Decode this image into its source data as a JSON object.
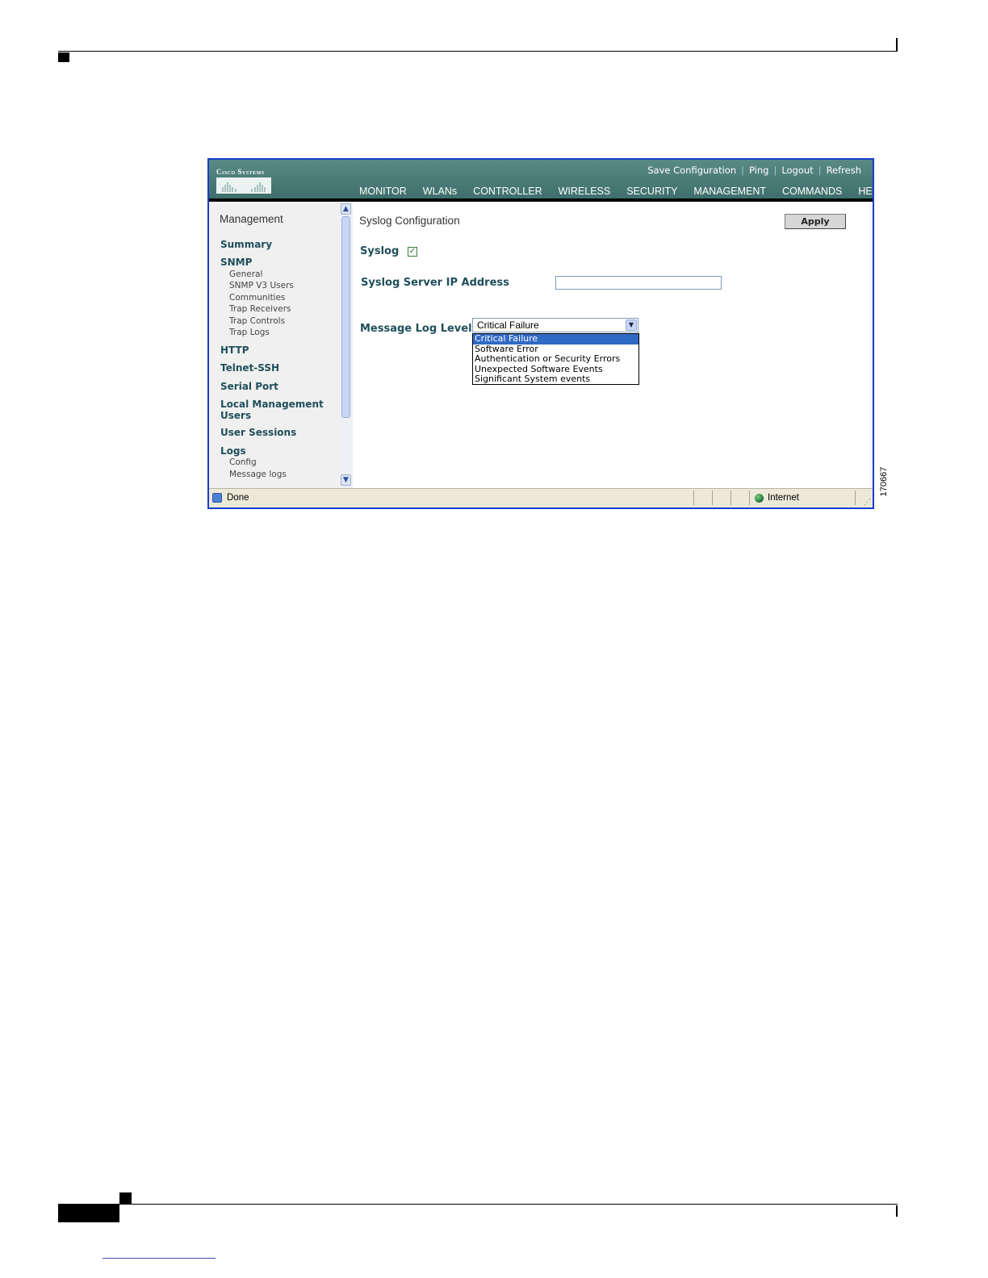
{
  "figure": {
    "id": "170667"
  },
  "header": {
    "brand": "Cisco Systems",
    "util_links": [
      "Save Configuration",
      "Ping",
      "Logout",
      "Refresh"
    ],
    "nav": [
      "MONITOR",
      "WLANs",
      "CONTROLLER",
      "WIRELESS",
      "SECURITY",
      "MANAGEMENT",
      "COMMANDS",
      "HELP"
    ],
    "active_nav": "MANAGEMENT",
    "active_color": "#e79a35"
  },
  "sidebar": {
    "title": "Management",
    "summary": "Summary",
    "snmp": "SNMP",
    "snmp_items": [
      "General",
      "SNMP V3 Users",
      "Communities",
      "Trap Receivers",
      "Trap Controls",
      "Trap Logs"
    ],
    "http": "HTTP",
    "telnet": "Telnet-SSH",
    "serial": "Serial Port",
    "local_mgmt_1": "Local Management",
    "local_mgmt_2": "Users",
    "user_sessions": "User Sessions",
    "logs": "Logs",
    "logs_items": [
      "Config",
      "Message logs"
    ]
  },
  "main": {
    "title": "Syslog Configuration",
    "apply": "Apply",
    "syslog_label": "Syslog",
    "syslog_checked": true,
    "server_ip_label": "Syslog Server IP Address",
    "server_ip_value": "",
    "log_level_label": "Message Log Level",
    "log_level_value": "Critical Failure",
    "log_level_options": [
      "Critical Failure",
      "Software Error",
      "Authentication or Security Errors",
      "Unexpected Software Events",
      "Significant System events"
    ]
  },
  "status": {
    "text": "Done",
    "zone": "Internet"
  }
}
